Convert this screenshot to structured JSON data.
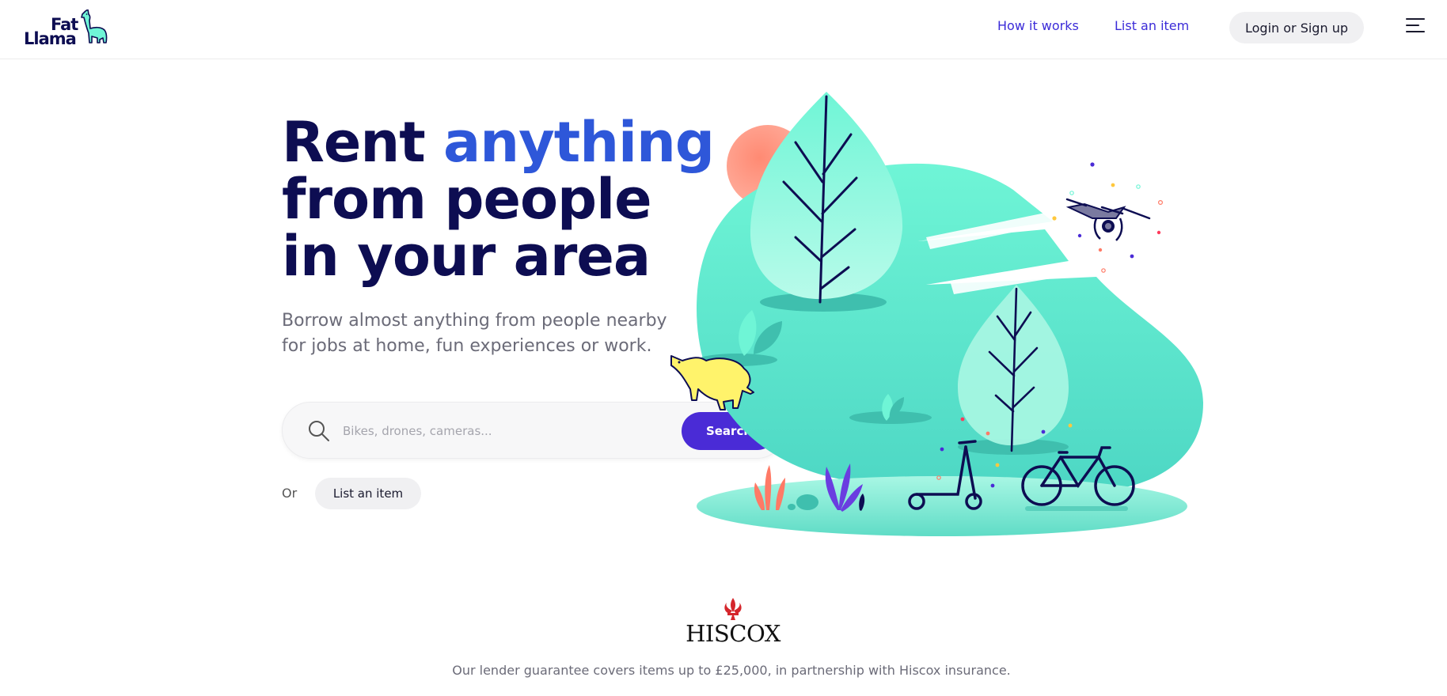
{
  "header": {
    "logo": {
      "line1": "Fat",
      "line2": "Llama"
    },
    "nav": {
      "how_it_works": "How it works",
      "list_item": "List an item"
    },
    "login_label": "Login or Sign up",
    "menu_icon": "hamburger-menu-icon"
  },
  "hero": {
    "title_word1": "Rent ",
    "title_accent": "anything",
    "title_rest": "from people in your area",
    "subtitle": "Borrow almost anything from people nearby for jobs at home, fun experiences or work.",
    "search": {
      "placeholder": "Bikes, drones, cameras...",
      "button": "Search",
      "icon": "search-icon"
    },
    "or_text": "Or",
    "list_button": "List an item"
  },
  "partner": {
    "name": "HISCOX",
    "text": "Our lender guarantee covers items up to £25,000, in partnership with Hiscox insurance."
  },
  "colors": {
    "navy": "#0d0d52",
    "accent_blue": "#2e57d9",
    "button_purple": "#4a2bd6",
    "mint": "#6ff5d6",
    "coral": "#ff6b5b"
  }
}
